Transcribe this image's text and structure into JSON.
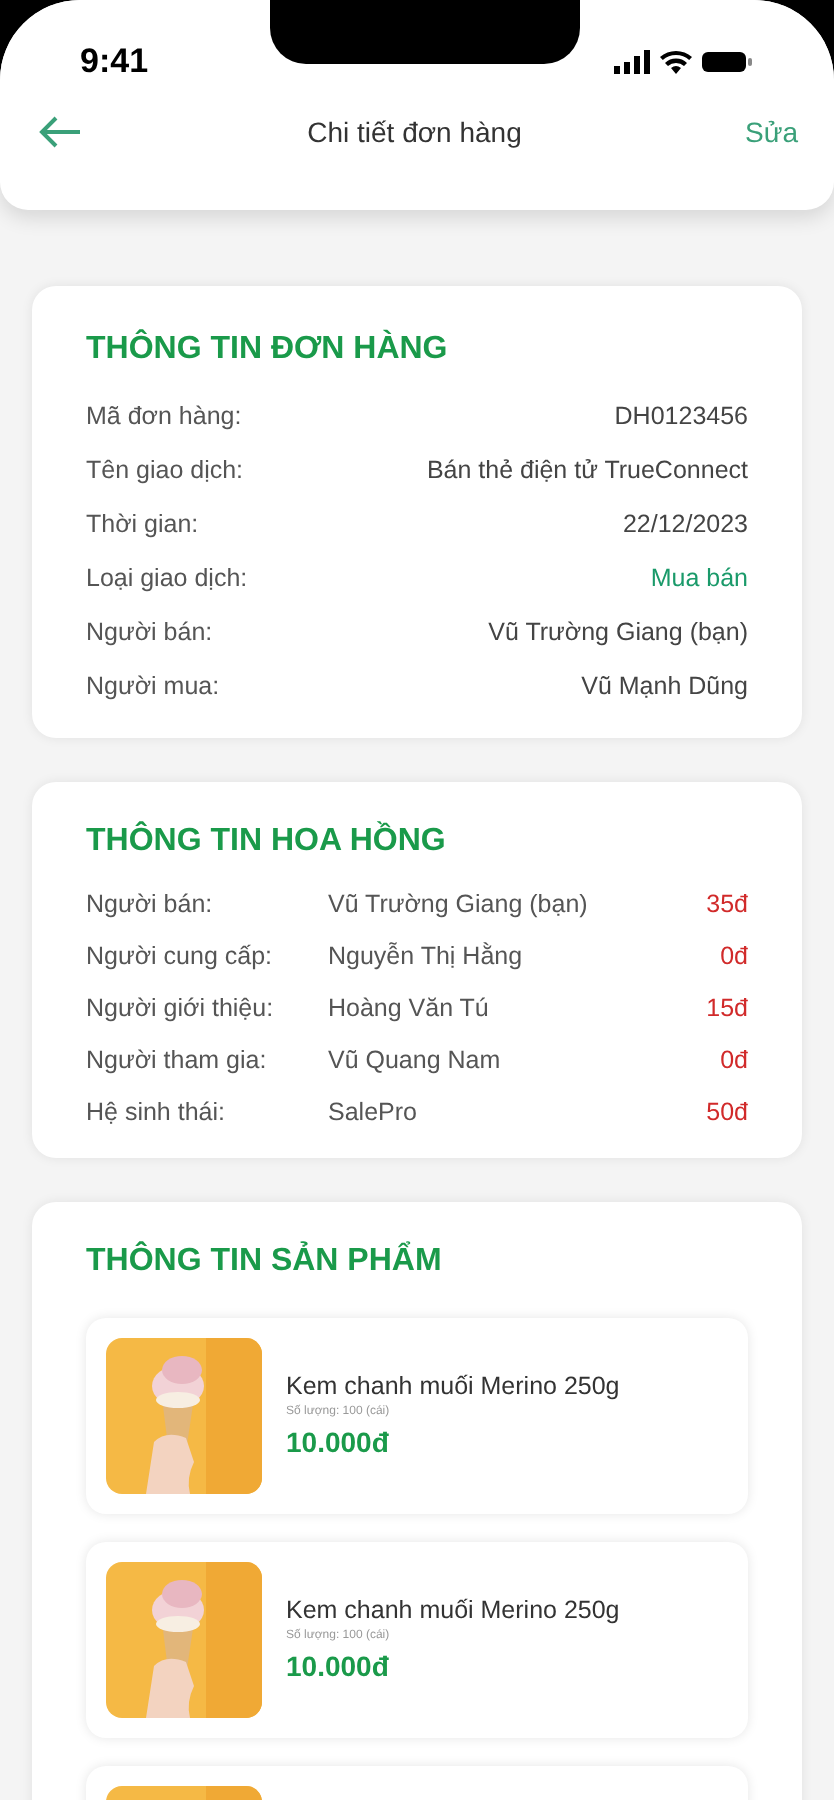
{
  "status_bar": {
    "time": "9:41"
  },
  "header": {
    "title": "Chi tiết đơn hàng",
    "action": "Sửa"
  },
  "order_info": {
    "title": "THÔNG TIN ĐƠN HÀNG",
    "rows": [
      {
        "label": "Mã đơn hàng:",
        "value": "DH0123456",
        "highlight": false
      },
      {
        "label": "Tên giao dịch:",
        "value": "Bán thẻ điện tử TrueConnect",
        "highlight": false
      },
      {
        "label": "Thời gian:",
        "value": "22/12/2023",
        "highlight": false
      },
      {
        "label": "Loại giao dịch:",
        "value": "Mua bán",
        "highlight": true
      },
      {
        "label": "Người bán:",
        "value": "Vũ Trường Giang (bạn)",
        "highlight": false
      },
      {
        "label": "Người mua:",
        "value": "Vũ Mạnh Dũng",
        "highlight": false
      }
    ]
  },
  "commission_info": {
    "title": "THÔNG TIN HOA HỒNG",
    "rows": [
      {
        "role": "Người bán:",
        "name": "Vũ Trường Giang (bạn)",
        "amount": "35đ"
      },
      {
        "role": "Người cung cấp:",
        "name": "Nguyễn Thị Hằng",
        "amount": "0đ"
      },
      {
        "role": "Người giới thiệu:",
        "name": "Hoàng Văn Tú",
        "amount": "15đ"
      },
      {
        "role": "Người tham gia:",
        "name": "Vũ Quang Nam",
        "amount": "0đ"
      },
      {
        "role": "Hệ sinh thái:",
        "name": "SalePro",
        "amount": "50đ"
      }
    ]
  },
  "product_info": {
    "title": "THÔNG TIN SẢN PHẨM",
    "products": [
      {
        "kind": "item",
        "name": "Kem chanh muối Merino 250g",
        "quantity": "Số lượng: 100 (cái)",
        "price": "10.000đ"
      },
      {
        "kind": "item",
        "name": "Kem chanh muối Merino 250g",
        "quantity": "Số lượng: 100 (cái)",
        "price": "10.000đ"
      },
      {
        "kind": "picture"
      }
    ]
  }
}
